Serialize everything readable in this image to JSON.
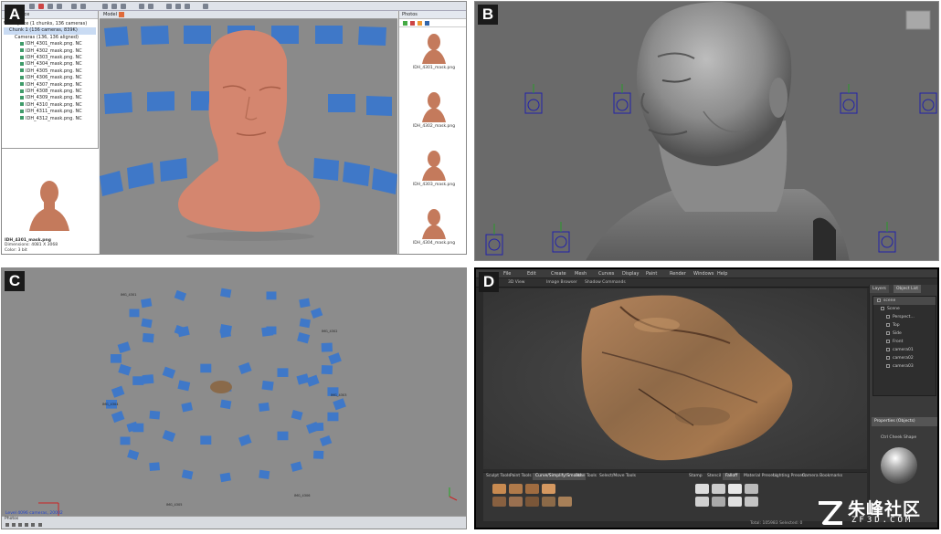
{
  "panels": {
    "a": {
      "label": "A",
      "workspace_title": "Workspace",
      "tree": [
        "Workspace (1 chunks, 136 cameras)",
        "Chunk 1 (136 cameras, 839K)",
        "Cameras (136, 136 aligned)",
        "IDH_4301_mask.png. NC",
        "IDH_4302_mask.png. NC",
        "IDH_4303_mask.png. NC",
        "IDH_4304_mask.png. NC",
        "IDH_4305_mask.png. NC",
        "IDH_4306_mask.png. NC",
        "IDH_4307_mask.png. NC",
        "IDH_4308_mask.png. NC",
        "IDH_4309_mask.png. NC",
        "IDH_4310_mask.png. NC",
        "IDH_4311_mask.png. NC",
        "IDH_4312_mask.png. NC"
      ],
      "thumb_caption": [
        "IDH_4301_mask.png",
        "Dimensions: 4081 X 3068",
        "Color: 3 bit"
      ],
      "view_tab": "Model",
      "photos_title": "Photos",
      "photos": [
        "IDH_4301_mask.png",
        "IDH_4302_mask.png",
        "IDH_4303_mask.png",
        "IDH_4304_mask.png"
      ],
      "colors": {
        "skin": "#d4866f",
        "camera": "#3f78c8",
        "viewport": "#8a8a8a"
      }
    },
    "b": {
      "label": "B",
      "colors": {
        "mesh": "#9a9a9a",
        "background": "#6a6a6a",
        "camera": "#2222aa"
      }
    },
    "c": {
      "label": "C",
      "status": "Level 4096 cameras, 20002",
      "bottom_tab": "Photos",
      "camera_labels": [
        "IMG_4301",
        "IMG_4302",
        "IMG_4303",
        "IMG_4304",
        "IMG_4305",
        "IMG_4306"
      ],
      "colors": {
        "camera": "#3f78c8",
        "background": "#8c8c8c"
      }
    },
    "d": {
      "label": "D",
      "menus": [
        "File",
        "Edit",
        "Create",
        "Mesh",
        "Curves",
        "Display",
        "Paint",
        "Render",
        "Windows",
        "Help"
      ],
      "subbar": [
        "3D View",
        "Image Browser",
        "Shadow Commands"
      ],
      "outliner_tabs": [
        "Layers",
        "Object List"
      ],
      "tree": [
        "scene",
        "Scene",
        "Perspect…",
        "Top",
        "Side",
        "Front",
        "camera01",
        "camera02",
        "camera03"
      ],
      "props_title": "Properties (Objects)",
      "mat_label": "Ctrl Cheek Shape",
      "tool_tabs": [
        "Sculpt Tools",
        "Paint Tools",
        "Curve/Simplify/Smooth",
        "Pose Tools",
        "Select/Move Tools"
      ],
      "tool_tabs2": [
        "Stamp",
        "Stencil",
        "Falloff",
        "Material Presets",
        "Lighting Presets",
        "Camera Bookmarks"
      ],
      "status": "Total: 105983 Selected: 0",
      "colors": {
        "rock": "#a8754c",
        "background": "#3a3a3a"
      }
    }
  },
  "watermark": {
    "text_zh": "朱峰社区",
    "text_en": "ZF3D.COM",
    "logo": "z-logo-icon"
  }
}
